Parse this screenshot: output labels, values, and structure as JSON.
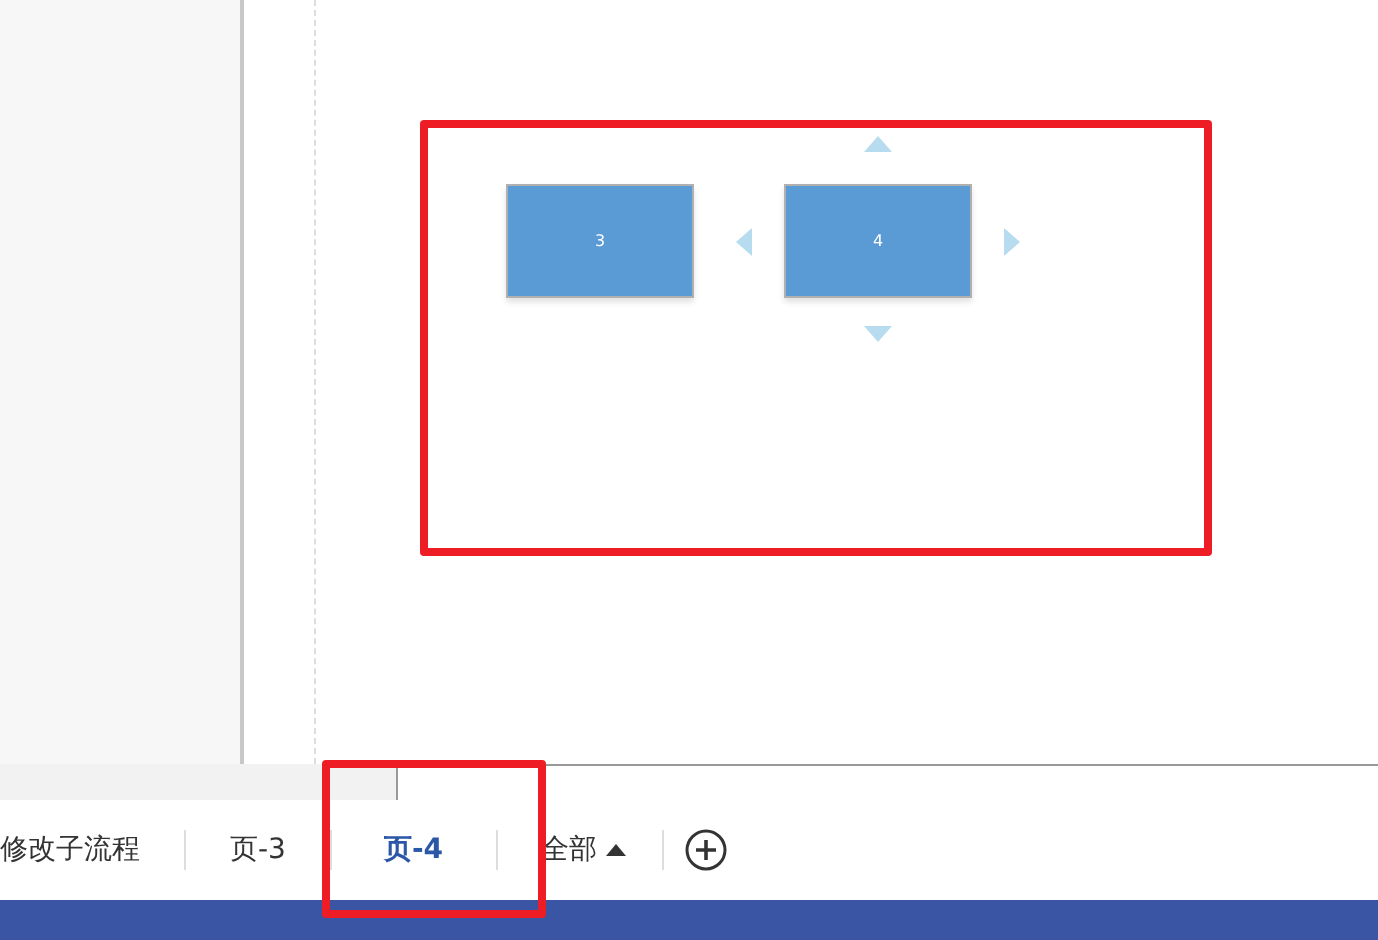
{
  "canvas": {
    "shapes": [
      {
        "label": "3"
      },
      {
        "label": "4",
        "selected": true
      }
    ]
  },
  "page_tabs": [
    {
      "label": "修改子流程",
      "kind": "page",
      "selected": false
    },
    {
      "label": "页-3",
      "kind": "page",
      "selected": false
    },
    {
      "label": "页-4",
      "kind": "page",
      "selected": true
    },
    {
      "label": "全部",
      "kind": "all",
      "selected": false
    }
  ]
}
